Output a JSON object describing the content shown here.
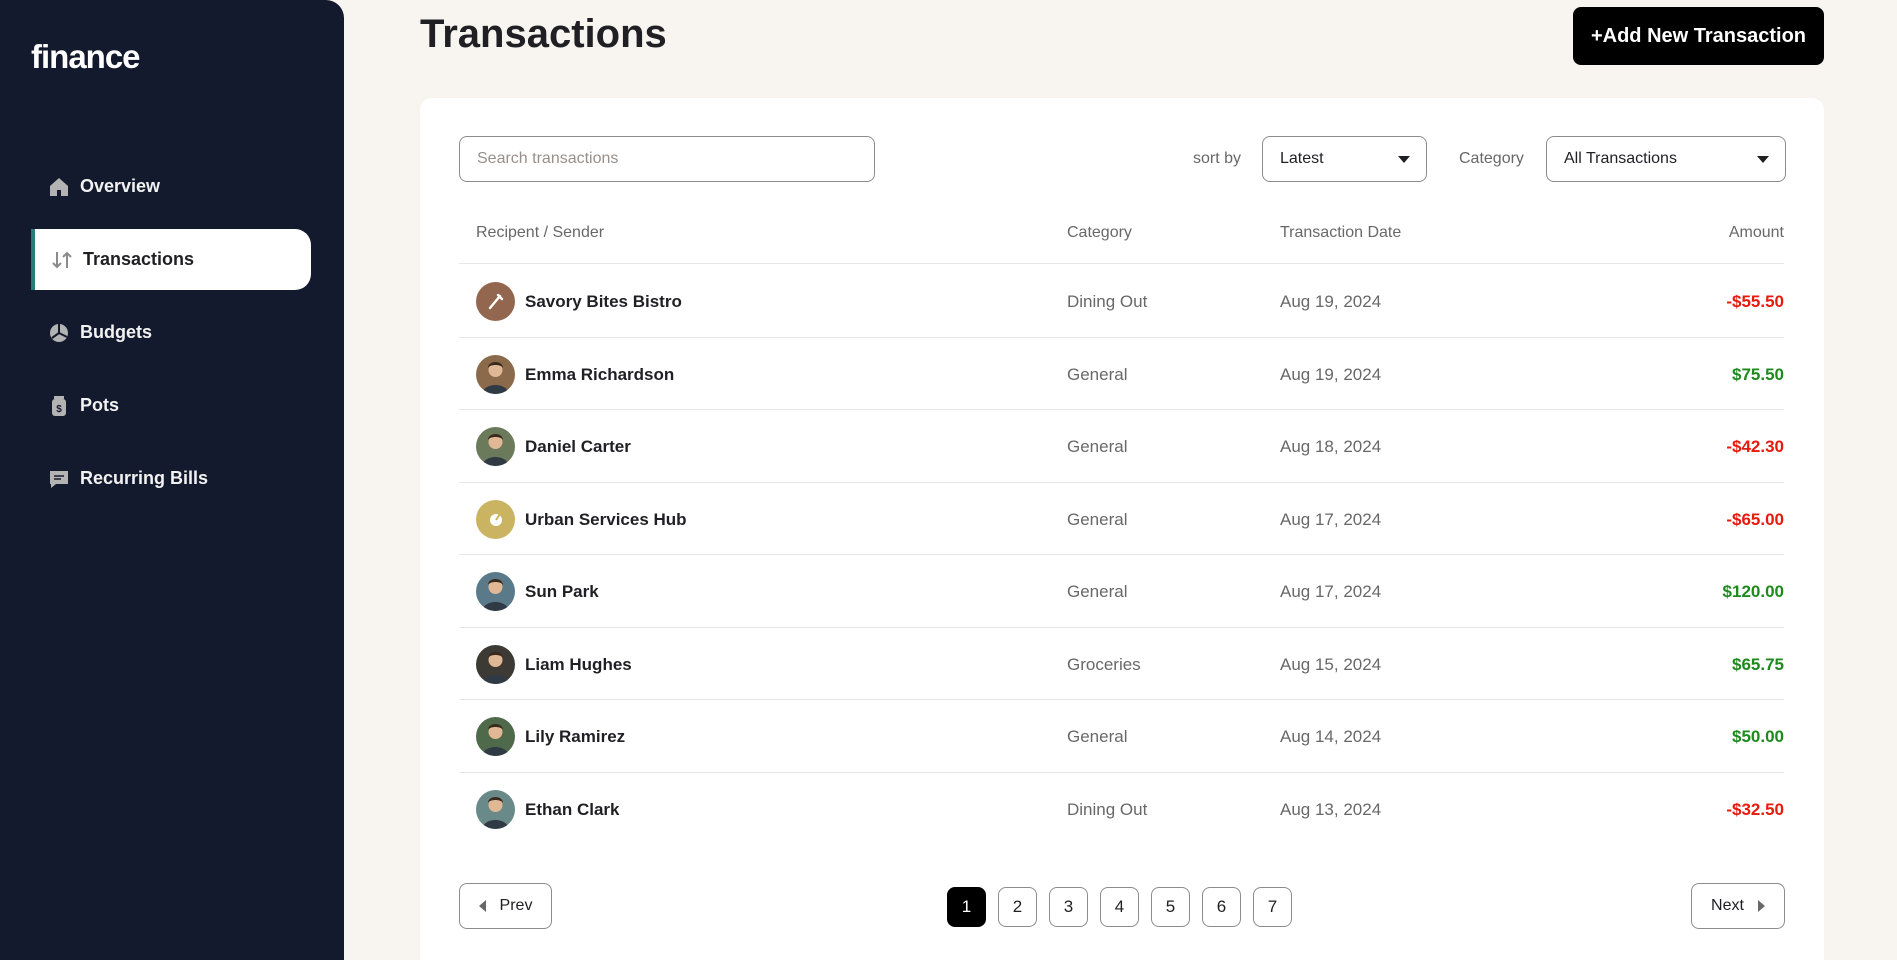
{
  "app": {
    "logo": "finance"
  },
  "sidebar": {
    "items": [
      {
        "label": "Overview",
        "icon": "home-icon",
        "active": false
      },
      {
        "label": "Transactions",
        "icon": "transactions-icon",
        "active": true
      },
      {
        "label": "Budgets",
        "icon": "pie-chart-icon",
        "active": false
      },
      {
        "label": "Pots",
        "icon": "jar-icon",
        "active": false
      },
      {
        "label": "Recurring Bills",
        "icon": "receipt-icon",
        "active": false
      }
    ]
  },
  "header": {
    "title": "Transactions",
    "add_button": "+Add New Transaction"
  },
  "filters": {
    "search_placeholder": "Search transactions",
    "sort_label": "sort by",
    "sort_value": "Latest",
    "category_label": "Category",
    "category_value": "All Transactions"
  },
  "table": {
    "headers": {
      "recipient": "Recipent / Sender",
      "category": "Category",
      "date": "Transaction Date",
      "amount": "Amount"
    },
    "rows": [
      {
        "name": "Savory Bites Bistro",
        "category": "Dining Out",
        "date": "Aug 19, 2024",
        "amount": "-$55.50",
        "type": "debit",
        "avatar": "utensils-icon",
        "avatar_color": "#93674f"
      },
      {
        "name": "Emma Richardson",
        "category": "General",
        "date": "Aug 19, 2024",
        "amount": "$75.50",
        "type": "credit",
        "avatar": "person-photo",
        "avatar_color": "#8a6a4a"
      },
      {
        "name": "Daniel Carter",
        "category": "General",
        "date": "Aug 18, 2024",
        "amount": "-$42.30",
        "type": "debit",
        "avatar": "person-photo",
        "avatar_color": "#6b7a5a"
      },
      {
        "name": "Urban Services Hub",
        "category": "General",
        "date": "Aug 17, 2024",
        "amount": "-$65.00",
        "type": "debit",
        "avatar": "tool-icon",
        "avatar_color": "#cab361"
      },
      {
        "name": "Sun Park",
        "category": "General",
        "date": "Aug 17, 2024",
        "amount": "$120.00",
        "type": "credit",
        "avatar": "person-photo",
        "avatar_color": "#5a7a8a"
      },
      {
        "name": "Liam Hughes",
        "category": "Groceries",
        "date": "Aug 15, 2024",
        "amount": "$65.75",
        "type": "credit",
        "avatar": "person-photo",
        "avatar_color": "#3d3a36"
      },
      {
        "name": "Lily Ramirez",
        "category": "General",
        "date": "Aug 14, 2024",
        "amount": "$50.00",
        "type": "credit",
        "avatar": "person-photo",
        "avatar_color": "#4f6a4a"
      },
      {
        "name": "Ethan Clark",
        "category": "Dining Out",
        "date": "Aug 13, 2024",
        "amount": "-$32.50",
        "type": "debit",
        "avatar": "person-photo",
        "avatar_color": "#6a8a8a"
      }
    ]
  },
  "pagination": {
    "prev": "Prev",
    "next": "Next",
    "pages": [
      "1",
      "2",
      "3",
      "4",
      "5",
      "6",
      "7"
    ],
    "current": "1"
  },
  "colors": {
    "sidebar_bg": "#141a2e",
    "page_bg": "#f8f5f0",
    "accent": "#277c78",
    "credit": "#1e8a1e",
    "debit": "#e8190d"
  }
}
